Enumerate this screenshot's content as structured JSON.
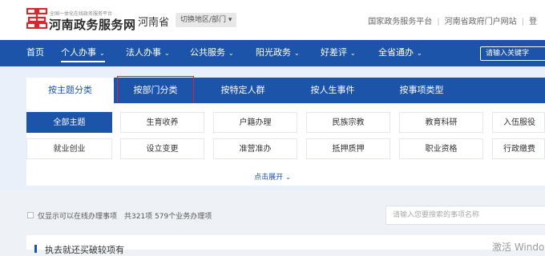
{
  "header": {
    "brand_small": "全国一体化在线政务服务平台",
    "brand_name": "河南政务服务网",
    "region": "河南省",
    "switch_label": "切换地区/部门",
    "links": [
      "国家政务服务平台",
      "河南省政府门户网站",
      "登"
    ]
  },
  "nav": {
    "items": [
      {
        "label": "首页",
        "has_dropdown": false
      },
      {
        "label": "个人办事",
        "has_dropdown": true,
        "active": true
      },
      {
        "label": "法人办事",
        "has_dropdown": true
      },
      {
        "label": "公共服务",
        "has_dropdown": true
      },
      {
        "label": "阳光政务",
        "has_dropdown": true
      },
      {
        "label": "好差评",
        "has_dropdown": true
      },
      {
        "label": "全省通办",
        "has_dropdown": true
      }
    ],
    "search_placeholder": "请输入关键字"
  },
  "tabs": [
    {
      "label": "按主题分类",
      "active": true
    },
    {
      "label": "按部门分类",
      "highlighted": true
    },
    {
      "label": "按特定人群"
    },
    {
      "label": "按人生事件"
    },
    {
      "label": "按事项类型"
    }
  ],
  "topics": {
    "row1": [
      "全部主题",
      "生育收养",
      "户籍办理",
      "民族宗教",
      "教育科研",
      "入伍服役"
    ],
    "row2": [
      "就业创业",
      "设立变更",
      "准营准办",
      "抵押质押",
      "职业资格",
      "行政缴费"
    ]
  },
  "expand_label": "点击展开",
  "filter": {
    "online_only_label": "仅显示可以在线办理事项",
    "count_text": "共321项 579个业务办理项",
    "search_placeholder": "请输入您要搜索的事项名称"
  },
  "result": {
    "title": "执去就还买破较项有"
  },
  "watermark": "激活 Windo",
  "colors": {
    "brand": "#1c54a9",
    "logo_red": "#d7282f",
    "highlight": "#e0232e"
  }
}
